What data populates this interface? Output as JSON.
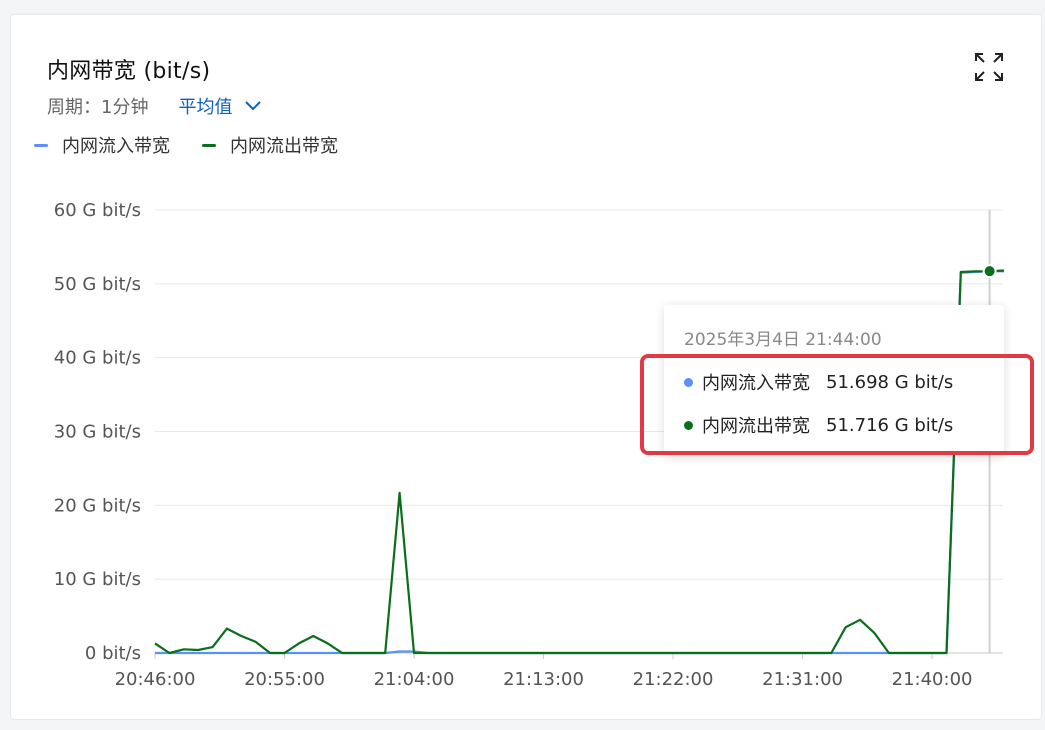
{
  "panel": {
    "title": "内网带宽 (bit/s)",
    "period_label": "周期：1分钟",
    "aggregation": "平均值"
  },
  "icons": {
    "expand": "expand-icon",
    "dropdown": "chevron-down-icon"
  },
  "colors": {
    "inbound": "#5b8ff9",
    "outbound": "#0a6e1a",
    "accent": "#0b5fc5",
    "highlight": "#e03a44"
  },
  "legend": [
    {
      "name": "内网流入带宽",
      "color": "#5b8ff9"
    },
    {
      "name": "内网流出带宽",
      "color": "#0a6e1a"
    }
  ],
  "tooltip": {
    "time": "2025年3月4日 21:44:00",
    "rows": [
      {
        "name": "内网流入带宽",
        "value": "51.698 G bit/s",
        "color": "#5b8ff9"
      },
      {
        "name": "内网流出带宽",
        "value": "51.716 G bit/s",
        "color": "#0a6e1a"
      }
    ]
  },
  "chart_data": {
    "type": "line",
    "xlabel": "",
    "ylabel": "",
    "ylim": [
      0,
      60
    ],
    "y_ticks": [
      {
        "value": 0,
        "label": "0  bit/s"
      },
      {
        "value": 10,
        "label": "10 G bit/s"
      },
      {
        "value": 20,
        "label": "20 G bit/s"
      },
      {
        "value": 30,
        "label": "30 G bit/s"
      },
      {
        "value": 40,
        "label": "40 G bit/s"
      },
      {
        "value": 50,
        "label": "50 G bit/s"
      },
      {
        "value": 60,
        "label": "60 G bit/s"
      }
    ],
    "x_ticks": [
      "20:46:00",
      "20:55:00",
      "21:04:00",
      "21:13:00",
      "21:22:00",
      "21:31:00",
      "21:40:00"
    ],
    "grid": true,
    "legend_position": "top-left",
    "x": [
      "20:46:00",
      "20:47:00",
      "20:48:00",
      "20:49:00",
      "20:50:00",
      "20:51:00",
      "20:52:00",
      "20:53:00",
      "20:54:00",
      "20:55:00",
      "20:56:00",
      "20:57:00",
      "20:58:00",
      "20:59:00",
      "21:00:00",
      "21:01:00",
      "21:02:00",
      "21:03:00",
      "21:04:00",
      "21:05:00",
      "21:06:00",
      "21:07:00",
      "21:08:00",
      "21:09:00",
      "21:10:00",
      "21:11:00",
      "21:12:00",
      "21:13:00",
      "21:14:00",
      "21:15:00",
      "21:16:00",
      "21:17:00",
      "21:18:00",
      "21:19:00",
      "21:20:00",
      "21:21:00",
      "21:22:00",
      "21:23:00",
      "21:24:00",
      "21:25:00",
      "21:26:00",
      "21:27:00",
      "21:28:00",
      "21:29:00",
      "21:30:00",
      "21:31:00",
      "21:32:00",
      "21:33:00",
      "21:34:00",
      "21:35:00",
      "21:36:00",
      "21:37:00",
      "21:38:00",
      "21:39:00",
      "21:40:00",
      "21:41:00",
      "21:42:00",
      "21:43:00",
      "21:44:00",
      "21:45:00"
    ],
    "series": [
      {
        "name": "内网流入带宽",
        "values": [
          0,
          0,
          0,
          0,
          0,
          0,
          0,
          0,
          0,
          0,
          0,
          0,
          0,
          0,
          0,
          0,
          0,
          0.2,
          0.2,
          0,
          0,
          0,
          0,
          0,
          0,
          0,
          0,
          0,
          0,
          0,
          0,
          0,
          0,
          0,
          0,
          0,
          0,
          0,
          0,
          0,
          0,
          0,
          0,
          0,
          0,
          0,
          0,
          0,
          0,
          0,
          0,
          0,
          0,
          0,
          0,
          0,
          51.5,
          51.6,
          51.698,
          51.7
        ]
      },
      {
        "name": "内网流出带宽",
        "values": [
          1.3,
          0,
          0.5,
          0.4,
          0.8,
          3.3,
          2.3,
          1.5,
          0,
          0,
          1.3,
          2.3,
          1.3,
          0,
          0,
          0,
          0,
          21.7,
          0,
          0,
          0,
          0,
          0,
          0,
          0,
          0,
          0,
          0,
          0,
          0,
          0,
          0,
          0,
          0,
          0,
          0,
          0,
          0,
          0,
          0,
          0,
          0,
          0,
          0,
          0,
          0,
          0,
          0,
          3.5,
          4.5,
          2.7,
          0,
          0,
          0,
          0,
          0,
          51.6,
          51.7,
          51.716,
          51.8
        ]
      }
    ]
  }
}
